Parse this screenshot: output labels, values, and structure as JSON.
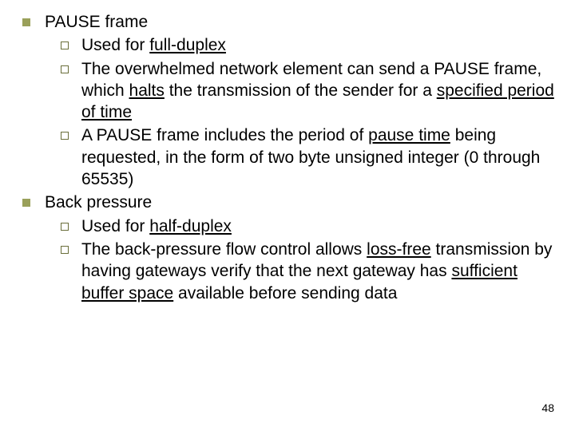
{
  "slide": {
    "items": [
      {
        "title": "PAUSE frame",
        "subs": [
          {
            "pre": "Used for ",
            "u": "full-duplex",
            "post": ""
          },
          {
            "pre": "The overwhelmed network element can send a PAUSE frame, which ",
            "u": "halts",
            "mid": " the transmission of the sender for a ",
            "u2": "specified period of time",
            "post": ""
          },
          {
            "pre": "A PAUSE frame includes the period of ",
            "u": "pause time",
            "post": " being requested, in the form of two byte unsigned integer (0 through 65535)"
          }
        ]
      },
      {
        "title": "Back pressure",
        "subs": [
          {
            "pre": "Used for ",
            "u": "half-duplex",
            "post": ""
          },
          {
            "pre": "The back-pressure flow control allows ",
            "u": "loss-free",
            "mid": " transmission by having gateways verify that the next gateway has ",
            "u2": "sufficient buffer space",
            "post": " available before sending data"
          }
        ]
      }
    ],
    "page_number": "48"
  }
}
